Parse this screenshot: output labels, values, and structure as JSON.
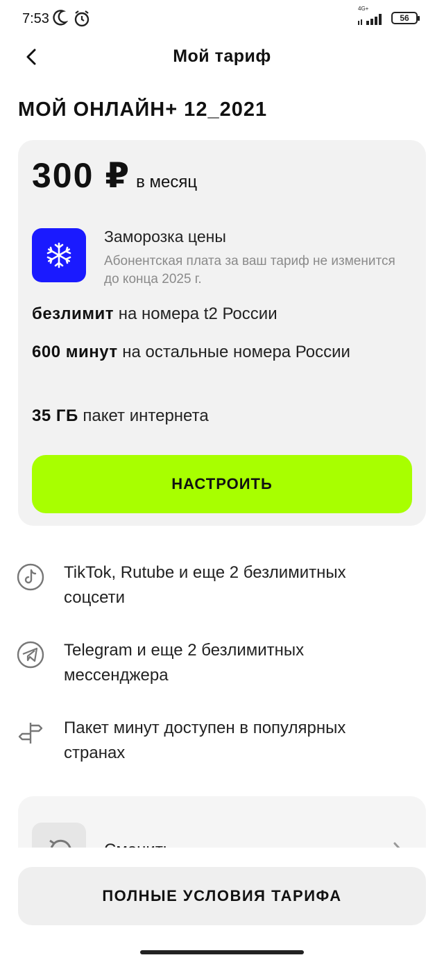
{
  "status_bar": {
    "time": "7:53",
    "network": "4G+",
    "battery": "56"
  },
  "header": {
    "title": "Мой тариф"
  },
  "plan": {
    "name": "МОЙ ОНЛАЙН+ 12_2021",
    "price": "300 ₽",
    "price_period": "в месяц",
    "freeze_title": "Заморозка цены",
    "freeze_description": "Абонентская плата за ваш тариф не изменится до конца 2025 г.",
    "features": [
      {
        "bold": "безлимит",
        "text": " на номера t2 России"
      },
      {
        "bold": "600 минут",
        "text": " на остальные номера России"
      },
      {
        "bold": "35 ГБ",
        "text": " пакет интернета"
      }
    ],
    "configure_label": "НАСТРОИТЬ"
  },
  "perks": [
    {
      "icon": "tiktok-icon",
      "text": "TikTok, Rutube и еще 2 безлимитных соцсети"
    },
    {
      "icon": "telegram-icon",
      "text": "Telegram и еще 2 безлимитных мессенджера"
    },
    {
      "icon": "signpost-icon",
      "text": "Пакет минут доступен в популярных странах"
    }
  ],
  "change_card": {
    "label": "Сменить"
  },
  "bottom": {
    "terms_label": "ПОЛНЫЕ УСЛОВИЯ ТАРИФА"
  },
  "colors": {
    "accent": "#a8ff00",
    "freeze_blue": "#1a1aff",
    "card_bg": "#f2f2f2"
  }
}
